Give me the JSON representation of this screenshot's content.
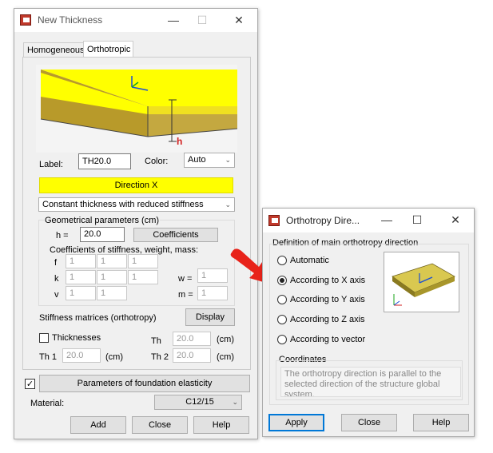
{
  "left_dialog": {
    "title": "New Thickness",
    "tabs": [
      "Homogeneous",
      "Orthotropic"
    ],
    "label_caption": "Label:",
    "label_value": "TH20.0",
    "color_caption": "Color:",
    "color_value": "Auto",
    "direction_button": "Direction X",
    "thickness_type": "Constant thickness with reduced stiffness",
    "geom_title": "Geometrical parameters (cm)",
    "h_label": "h  =",
    "h_value": "20.0",
    "coefficients_button": "Coefficients",
    "coef_title": "Coefficients of stiffness, weight, mass:",
    "f_label": "f",
    "k_label": "k",
    "v_label": "v",
    "f_values": [
      "1",
      "1",
      "1"
    ],
    "k_values": [
      "1",
      "1",
      "1"
    ],
    "v_values": [
      "1",
      "1"
    ],
    "w_label": "w =",
    "w_value": "1",
    "m_label": "m =",
    "m_value": "1",
    "stiffness_label": "Stiffness matrices (orthotropy)",
    "display_button": "Display",
    "thicknesses_label": "Thicknesses",
    "th_label": "Th",
    "th_value": "20.0",
    "th_unit": "(cm)",
    "th1_label": "Th 1",
    "th1_value": "20.0",
    "th1_unit": "(cm)",
    "th2_label": "Th 2",
    "th2_value": "20.0",
    "th2_unit": "(cm)",
    "foundation_button": "Parameters of foundation elasticity",
    "material_label": "Material:",
    "material_value": "C12/15",
    "add_button": "Add",
    "close_button": "Close",
    "help_button": "Help",
    "image_h_label": "h"
  },
  "right_dialog": {
    "title": "Orthotropy Dire...",
    "group_title": "Definition of main orthotropy direction",
    "options": [
      "Automatic",
      "According to X axis",
      "According to Y axis",
      "According to Z axis",
      "According to vector"
    ],
    "selected_index": 1,
    "coordinates_title": "Coordinates",
    "coordinates_text": "The orthotropy direction is parallel to the selected direction of the structure global system.",
    "apply_button": "Apply",
    "close_button": "Close",
    "help_button": "Help"
  },
  "colors": {
    "highlight": "#ffff00",
    "arrow": "#e8231a",
    "slab_top": "#d9c850",
    "slab_side": "#8a7a20"
  }
}
